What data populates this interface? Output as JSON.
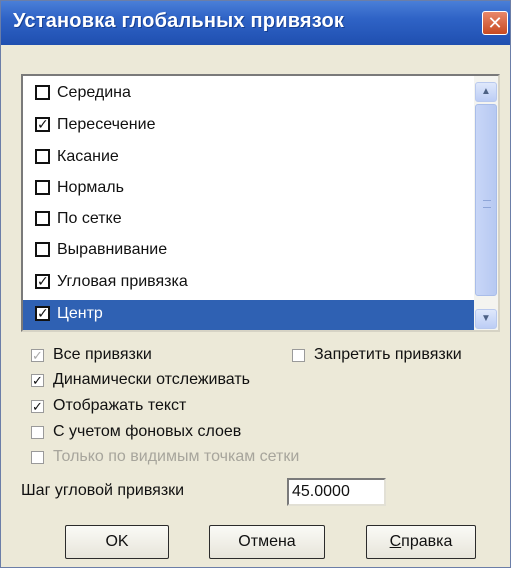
{
  "window": {
    "title": "Установка глобальных привязок",
    "close_glyph": "✕"
  },
  "snap_list": {
    "items": [
      {
        "label": "Середина",
        "checked": false,
        "selected": false
      },
      {
        "label": "Пересечение",
        "checked": true,
        "selected": false
      },
      {
        "label": "Касание",
        "checked": false,
        "selected": false
      },
      {
        "label": "Нормаль",
        "checked": false,
        "selected": false
      },
      {
        "label": "По сетке",
        "checked": false,
        "selected": false
      },
      {
        "label": "Выравнивание",
        "checked": false,
        "selected": false
      },
      {
        "label": "Угловая привязка",
        "checked": true,
        "selected": false
      },
      {
        "label": "Центр",
        "checked": true,
        "selected": true
      }
    ]
  },
  "options": {
    "all_snaps": {
      "label": "Все привязки",
      "checked": true,
      "disabled": true
    },
    "forbid_snaps": {
      "label": "Запретить привязки",
      "checked": false,
      "disabled": false
    },
    "dynamic_tracking": {
      "label": "Динамически отслеживать",
      "checked": true,
      "disabled": false
    },
    "show_text": {
      "label": "Отображать текст",
      "checked": true,
      "disabled": false
    },
    "background_layers": {
      "label": "С учетом фоновых слоев",
      "checked": false,
      "disabled": false
    },
    "visible_grid_points": {
      "label": "Только по видимым точкам сетки",
      "checked": false,
      "disabled": true
    }
  },
  "angle_step": {
    "label": "Шаг угловой привязки",
    "value": "45.0000"
  },
  "buttons": {
    "ok": "OK",
    "cancel": "Отмена",
    "help_prefix": "С",
    "help_rest": "правка"
  },
  "colors": {
    "titlebar": "#2f63c6",
    "selection": "#2f61b3",
    "dialog_bg": "#ece9d8"
  }
}
